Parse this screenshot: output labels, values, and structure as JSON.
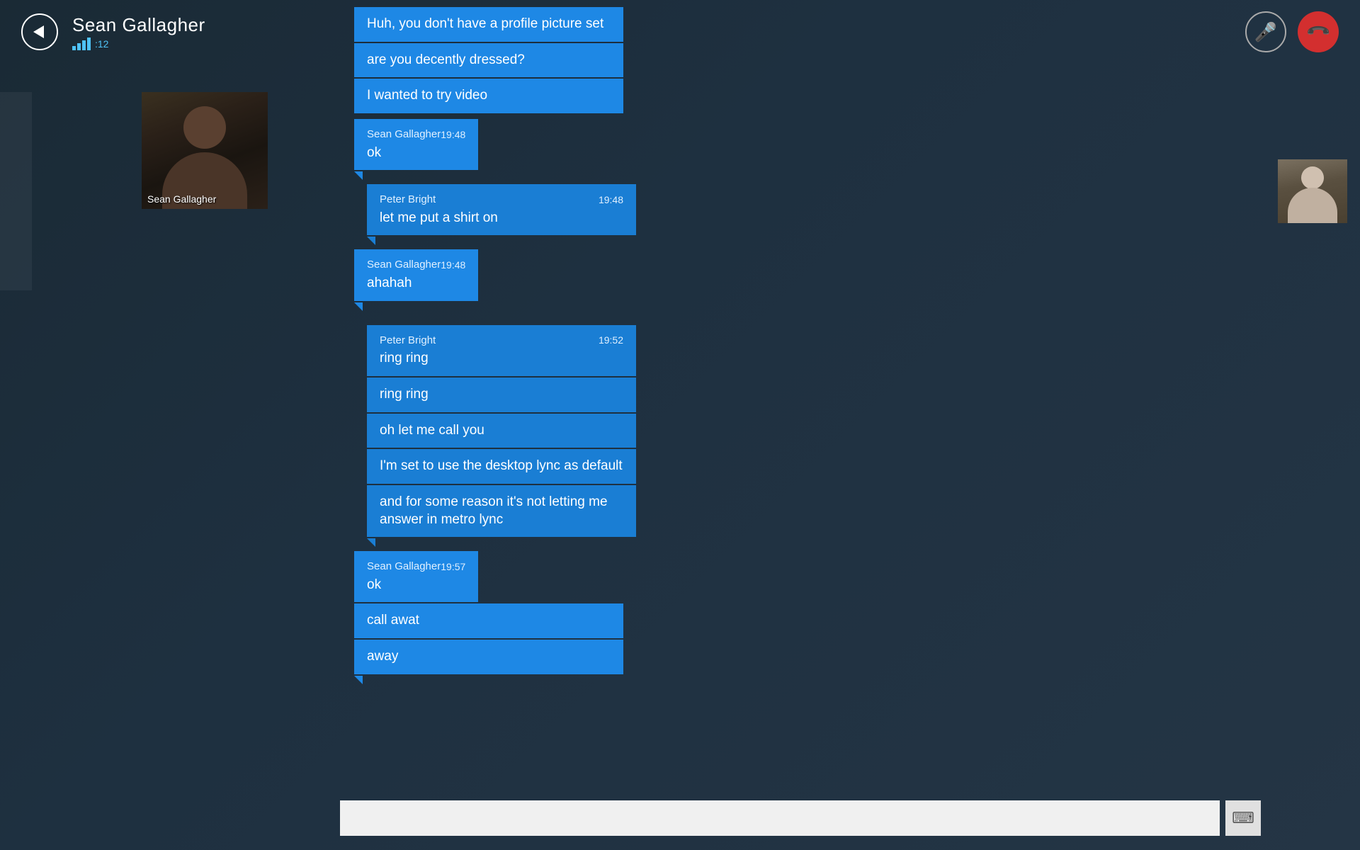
{
  "header": {
    "back_label": "←",
    "contact_name": "Sean Gallagher",
    "signal_count": ":12",
    "mic_icon": "🎤",
    "end_call_icon": "📞"
  },
  "left_video": {
    "label": "Sean Gallagher"
  },
  "messages": [
    {
      "id": "msg1",
      "type": "standalone_peter",
      "text": "Huh, you don't have a profile picture set"
    },
    {
      "id": "msg2",
      "type": "standalone_peter",
      "text": "are you decently dressed?"
    },
    {
      "id": "msg3",
      "type": "standalone_peter",
      "text": "I wanted to try video"
    },
    {
      "id": "msg4",
      "type": "sean_header",
      "sender": "Sean Gallagher",
      "time": "19:48",
      "text": "ok"
    },
    {
      "id": "msg5",
      "type": "peter_header",
      "sender": "Peter Bright",
      "time": "19:48",
      "text": "let me put a shirt on"
    },
    {
      "id": "msg6",
      "type": "sean_header",
      "sender": "Sean Gallagher",
      "time": "19:48",
      "text": "ahahah"
    },
    {
      "id": "msg7",
      "type": "peter_header",
      "sender": "Peter Bright",
      "time": "19:52",
      "text": "ring ring"
    },
    {
      "id": "msg8",
      "type": "standalone_peter",
      "text": "ring ring"
    },
    {
      "id": "msg9",
      "type": "standalone_peter",
      "text": "oh let me call you"
    },
    {
      "id": "msg10",
      "type": "standalone_peter",
      "text": "I'm set to use the desktop lync as default"
    },
    {
      "id": "msg11",
      "type": "standalone_peter",
      "text": "and for some reason it's not letting me answer in metro lync"
    },
    {
      "id": "msg12",
      "type": "sean_header",
      "sender": "Sean Gallagher",
      "time": "19:57",
      "text": "ok"
    },
    {
      "id": "msg13",
      "type": "standalone_sean",
      "text": "call awat"
    },
    {
      "id": "msg14",
      "type": "standalone_sean",
      "text": "away"
    }
  ],
  "input": {
    "placeholder": "",
    "keyboard_icon": "⌨"
  }
}
